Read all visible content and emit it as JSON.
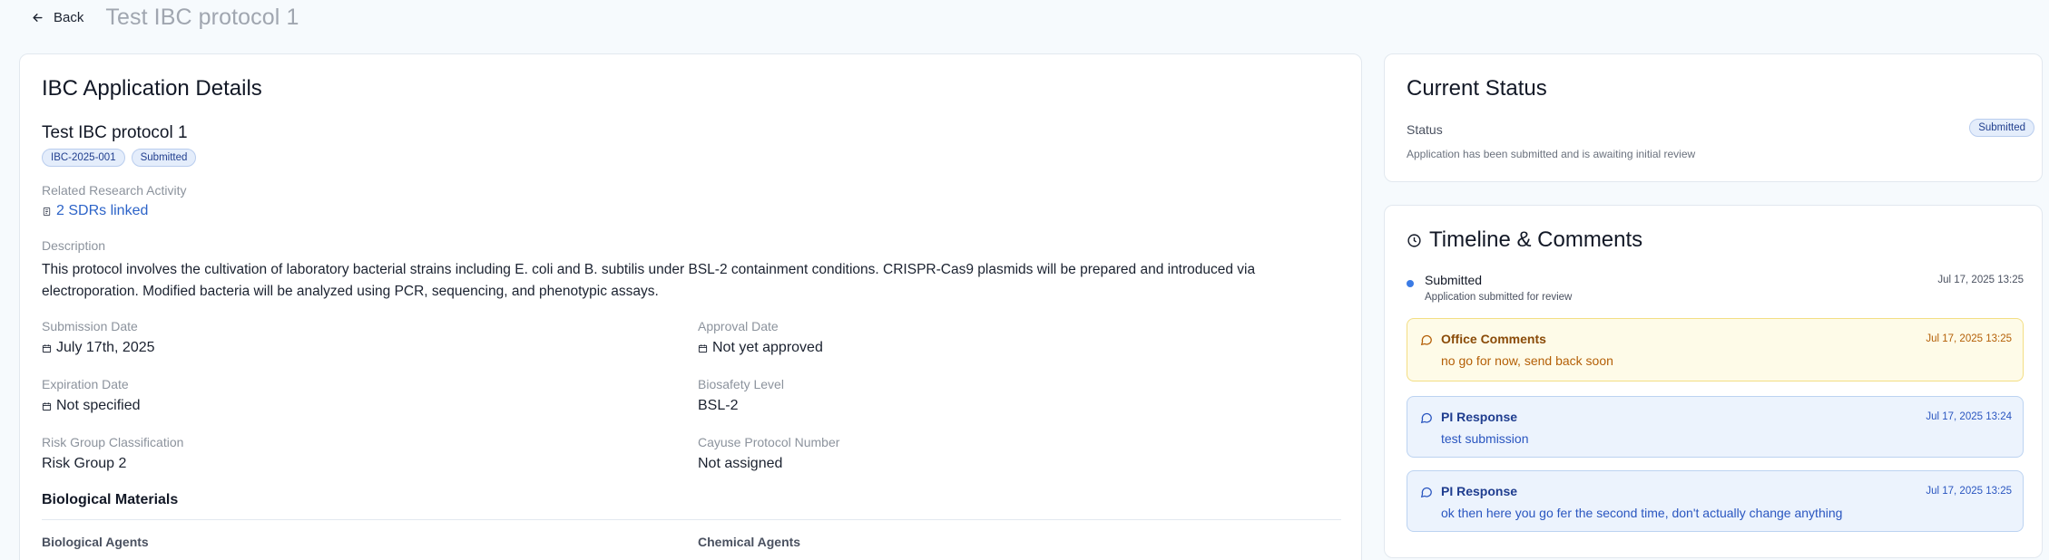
{
  "header": {
    "back_label": "Back",
    "page_title": "Test IBC protocol 1"
  },
  "details": {
    "card_title": "IBC Application Details",
    "app_name": "Test IBC protocol 1",
    "badges": [
      "IBC-2025-001",
      "Submitted"
    ],
    "related_label": "Related Research Activity",
    "related_value": "2 SDRs linked",
    "description_label": "Description",
    "description": "This protocol involves the cultivation of laboratory bacterial strains including E. coli and B. subtilis under BSL-2 containment conditions. CRISPR-Cas9 plasmids will be prepared and introduced via electroporation. Modified bacteria will be analyzed using PCR, sequencing, and phenotypic assays.",
    "fields": {
      "submission_date": {
        "label": "Submission Date",
        "value": "July 17th, 2025"
      },
      "approval_date": {
        "label": "Approval Date",
        "value": "Not yet approved"
      },
      "expiration_date": {
        "label": "Expiration Date",
        "value": "Not specified"
      },
      "biosafety_level": {
        "label": "Biosafety Level",
        "value": "BSL-2"
      },
      "risk_group": {
        "label": "Risk Group Classification",
        "value": "Risk Group 2"
      },
      "cayuse_number": {
        "label": "Cayuse Protocol Number",
        "value": "Not assigned"
      }
    },
    "section_title": "Biological Materials",
    "bio_agents_label": "Biological Agents",
    "chem_agents_label": "Chemical Agents"
  },
  "status": {
    "card_title": "Current Status",
    "label": "Status",
    "badge": "Submitted",
    "description": "Application has been submitted and is awaiting initial review"
  },
  "timeline": {
    "card_title": "Timeline & Comments",
    "event": {
      "title": "Submitted",
      "subtitle": "Application submitted for review",
      "time": "Jul 17, 2025 13:25"
    },
    "comments": [
      {
        "title": "Office Comments",
        "time": "Jul 17, 2025 13:25",
        "text": "no go for now, send back soon"
      },
      {
        "title": "PI Response",
        "time": "Jul 17, 2025 13:24",
        "text": "test submission"
      },
      {
        "title": "PI Response",
        "time": "Jul 17, 2025 13:25",
        "text": "ok then here you go fer the second time, don't actually change anything"
      }
    ]
  },
  "icons": {
    "back": "arrow-left-icon",
    "calendar": "calendar-icon",
    "link": "document-icon",
    "clock": "clock-icon",
    "comment": "message-circle-icon"
  },
  "colors": {
    "accent_blue": "#2c63c8",
    "badge_bg": "#e4edfb",
    "office_bg": "#fefbe8",
    "pi_bg": "#ecf3fd"
  }
}
